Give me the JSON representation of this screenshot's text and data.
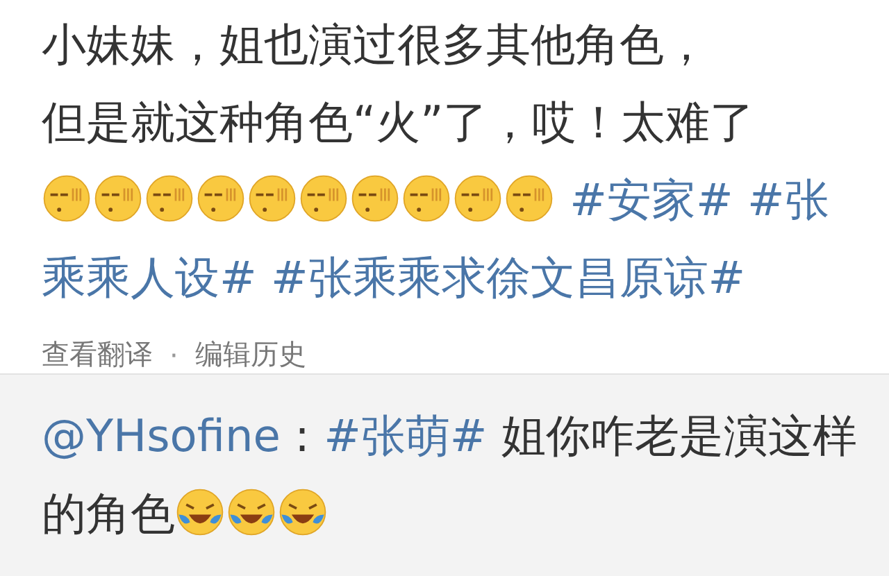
{
  "post": {
    "segments": [
      {
        "kind": "line",
        "text": "小妹妹，姐也演过很多其他角色，"
      },
      {
        "kind": "line",
        "text": "但是就这种角色“火”了，哎！太难了"
      },
      {
        "kind": "sleepy"
      },
      {
        "kind": "sleepy"
      },
      {
        "kind": "sleepy"
      },
      {
        "kind": "sleepy"
      },
      {
        "kind": "sleepy"
      },
      {
        "kind": "sleepy"
      },
      {
        "kind": "sleepy"
      },
      {
        "kind": "sleepy"
      },
      {
        "kind": "sleepy"
      },
      {
        "kind": "sleepy"
      },
      {
        "kind": "hashtag",
        "text": "#安家#"
      },
      {
        "kind": "hashtag",
        "text": "#张乘乘人设#"
      },
      {
        "kind": "hashtag",
        "text": "#张乘乘求徐文昌原谅#"
      }
    ],
    "actions": [
      {
        "label": "查看翻译"
      },
      {
        "label": "编辑历史"
      }
    ],
    "separator": "·"
  },
  "reply": {
    "segments": [
      {
        "kind": "mention",
        "text": "@YHsofine"
      },
      {
        "kind": "text",
        "text": " :"
      },
      {
        "kind": "hashtag",
        "text": "#张萌#"
      },
      {
        "kind": "text",
        "text": " 姐你咋老是演这样的角色"
      },
      {
        "kind": "laughing"
      },
      {
        "kind": "laughing"
      },
      {
        "kind": "laughing"
      }
    ]
  }
}
